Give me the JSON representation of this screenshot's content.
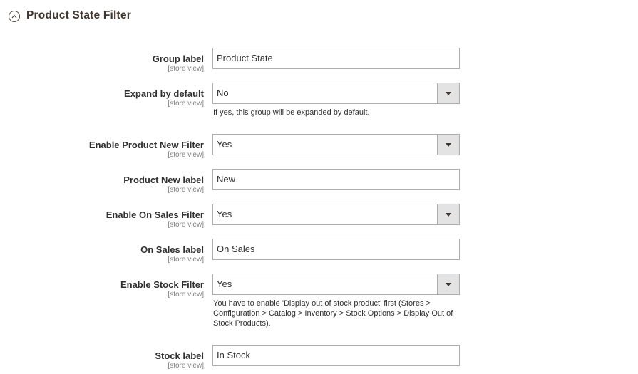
{
  "section": {
    "title": "Product State Filter",
    "icon": "collapse-circle-up-icon"
  },
  "fields": {
    "group_label": {
      "label": "Group label",
      "scope": "[store view]",
      "value": "Product State"
    },
    "expand_by_default": {
      "label": "Expand by default",
      "scope": "[store view]",
      "value": "No",
      "note": "If yes, this group will be expanded by default."
    },
    "enable_product_new": {
      "label": "Enable Product New Filter",
      "scope": "[store view]",
      "value": "Yes"
    },
    "product_new_label": {
      "label": "Product New label",
      "scope": "[store view]",
      "value": "New"
    },
    "enable_on_sales": {
      "label": "Enable On Sales Filter",
      "scope": "[store view]",
      "value": "Yes"
    },
    "on_sales_label": {
      "label": "On Sales label",
      "scope": "[store view]",
      "value": "On Sales"
    },
    "enable_stock": {
      "label": "Enable Stock Filter",
      "scope": "[store view]",
      "value": "Yes",
      "note": "You have to enable 'Display out of stock product' first (Stores > Configuration > Catalog > Inventory > Stock Options > Display Out of Stock Products)."
    },
    "stock_label": {
      "label": "Stock label",
      "scope": "[store view]",
      "value": "In Stock"
    }
  }
}
